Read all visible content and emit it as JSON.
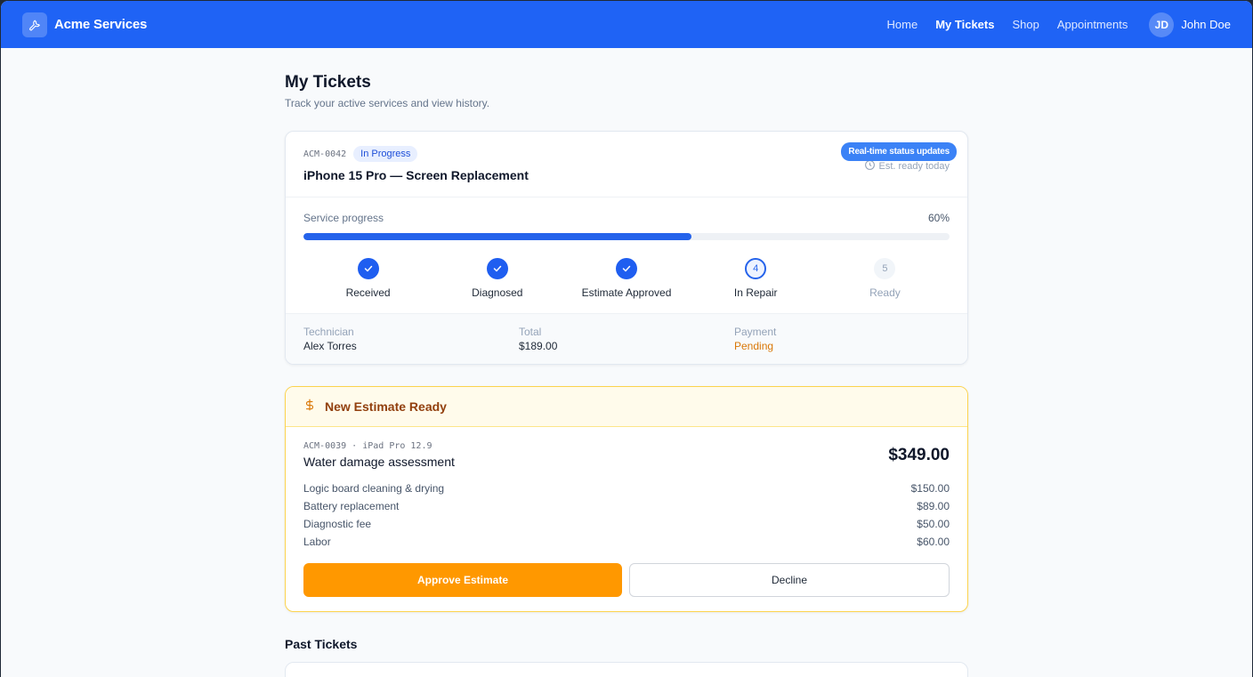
{
  "app": {
    "brand_name": "Acme Services",
    "brand_icon": "wrench-icon"
  },
  "nav": {
    "items": [
      {
        "label": "Home",
        "active": false
      },
      {
        "label": "My Tickets",
        "active": true
      },
      {
        "label": "Shop",
        "active": false
      },
      {
        "label": "Appointments",
        "active": false
      }
    ],
    "user_initials": "JD",
    "user_name": "John Doe"
  },
  "page": {
    "title": "My Tickets",
    "subtitle": "Track your active services and view history."
  },
  "active_ticket": {
    "id": "ACM-0042",
    "status": "In Progress",
    "title": "iPhone 15 Pro — Screen Replacement",
    "eta": "Est. ready today",
    "realtime_label": "Real-time status updates",
    "progress_label": "Service progress",
    "progress_percent_text": "60%",
    "progress_fraction": 0.6,
    "steps": [
      {
        "label": "Received",
        "state": "done",
        "number": "1"
      },
      {
        "label": "Diagnosed",
        "state": "done",
        "number": "2"
      },
      {
        "label": "Estimate Approved",
        "state": "done",
        "number": "3"
      },
      {
        "label": "In Repair",
        "state": "current",
        "number": "4"
      },
      {
        "label": "Ready",
        "state": "todo",
        "number": "5"
      }
    ],
    "technician_label": "Technician",
    "technician": "Alex Torres",
    "total_label": "Total",
    "total": "$189.00",
    "payment_label": "Payment",
    "payment": "Pending"
  },
  "estimate": {
    "header": "New Estimate Ready",
    "meta": "ACM-0039 · iPad Pro 12.9",
    "description": "Water damage assessment",
    "total": "$349.00",
    "items": [
      {
        "label": "Logic board cleaning & drying",
        "amount": "$150.00"
      },
      {
        "label": "Battery replacement",
        "amount": "$89.00"
      },
      {
        "label": "Diagnostic fee",
        "amount": "$50.00"
      },
      {
        "label": "Labor",
        "amount": "$60.00"
      }
    ],
    "approve_label": "Approve Estimate",
    "decline_label": "Decline"
  },
  "past": {
    "title": "Past Tickets"
  },
  "colors": {
    "brand": "#1f63f5",
    "progress": "#2563eb",
    "approve": "#ff9800",
    "pending": "#d97706"
  }
}
